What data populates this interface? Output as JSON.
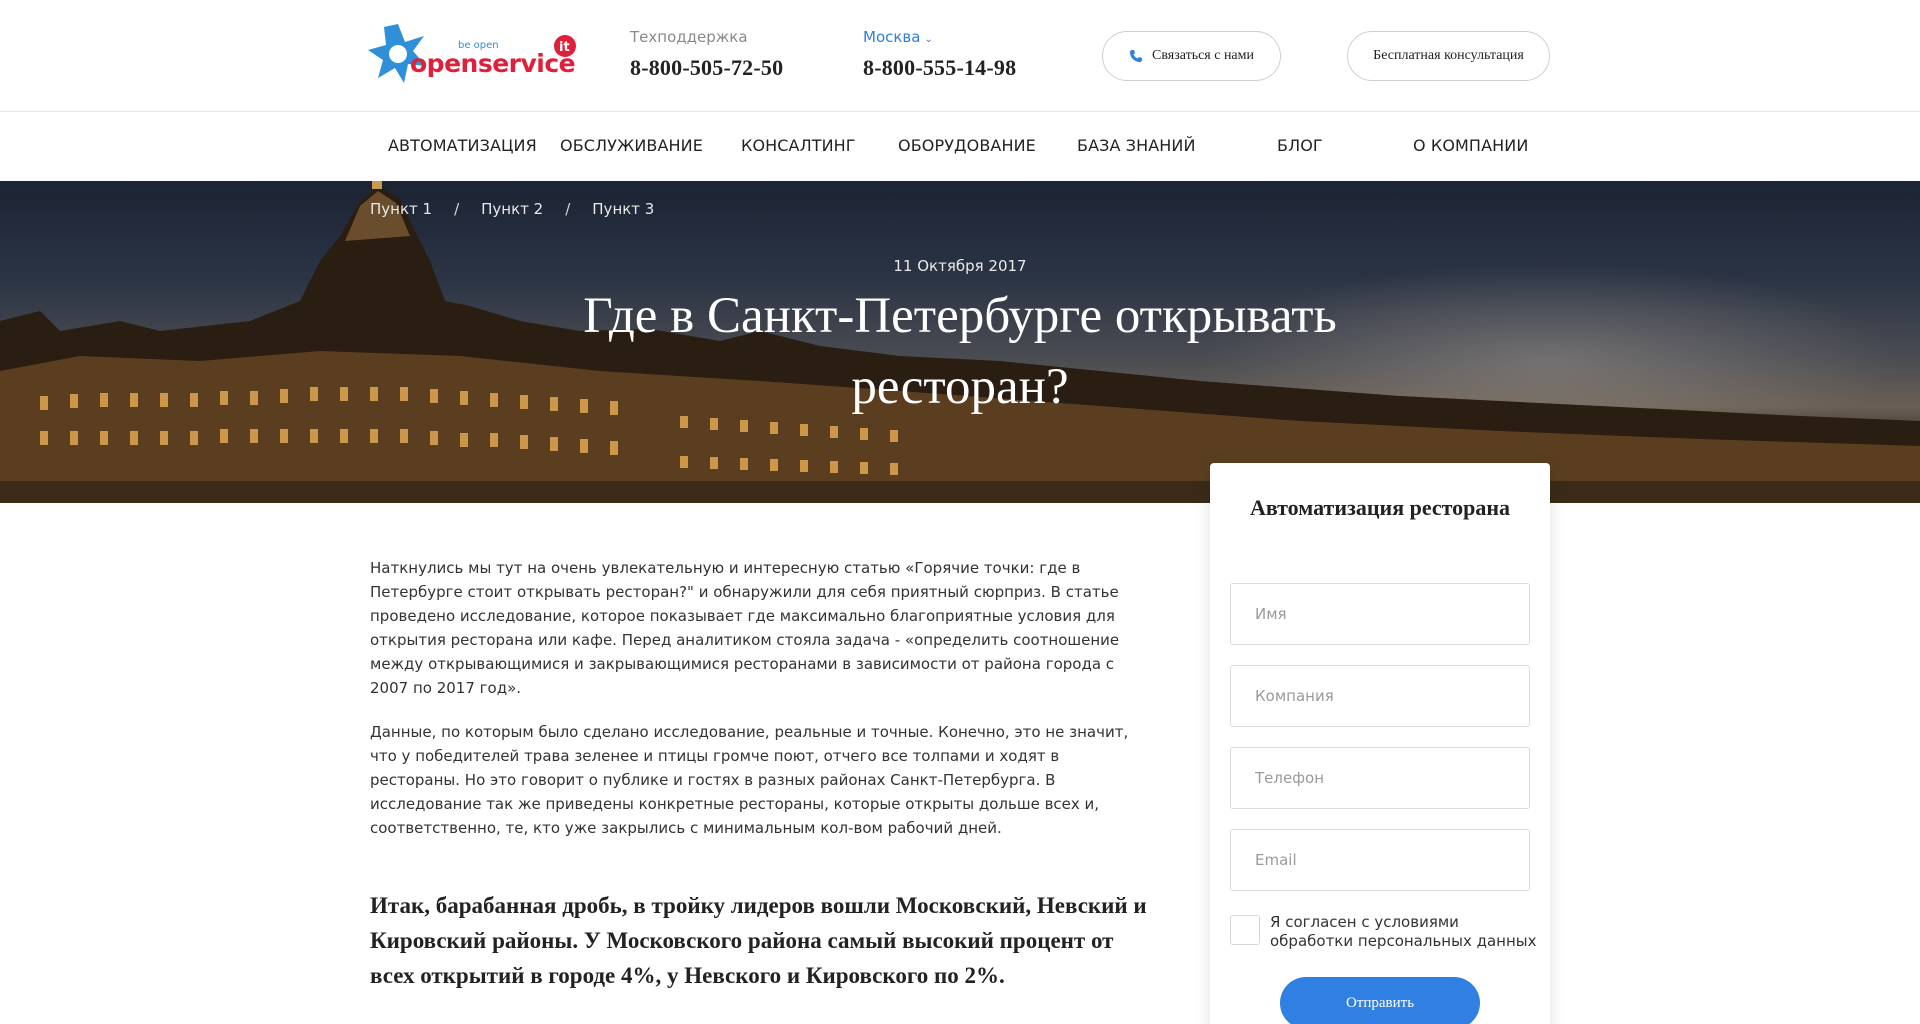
{
  "header": {
    "logo": {
      "small_text": "be open",
      "main_text": "openservice",
      "badge": "it",
      "icon": "star-snowflake-icon"
    },
    "support": {
      "label": "Техподдержка",
      "phone": "8-800-505-72-50"
    },
    "city": {
      "label": "Москва",
      "phone": "8-800-555-14-98"
    },
    "contact_button": "Связаться с нами",
    "consult_button": "Бесплатная консультация"
  },
  "nav": {
    "items": [
      {
        "label": "АВТОМАТИЗАЦИЯ"
      },
      {
        "label": "ОБСЛУЖИВАНИЕ"
      },
      {
        "label": "КОНСАЛТИНГ"
      },
      {
        "label": "ОБОРУДОВАНИЕ"
      },
      {
        "label": "БАЗА ЗНАНИЙ"
      },
      {
        "label": "БЛОГ"
      },
      {
        "label": "О КОМПАНИИ"
      }
    ]
  },
  "hero": {
    "breadcrumb": [
      "Пункт 1",
      "Пункт 2",
      "Пункт 3"
    ],
    "breadcrumb_sep": "/",
    "date": "11 Октября 2017",
    "title": "Где в Санкт-Петербурге открывать ресторан?"
  },
  "article": {
    "paragraphs": [
      "Наткнулись мы тут на очень увлекательную и интересную статью «Горячие точки: где в Петербурге стоит открывать ресторан?\" и обнаружили для себя приятный сюрприз. В статье проведено исследование, которое показывает где максимально благоприятные условия для открытия ресторана или кафе. Перед аналитиком стояла задача - «определить соотношение между открывающимися и закрывающимися ресторанами в зависимости от района города с 2007 по 2017 год».",
      "Данные, по которым было сделано исследование, реальные и точные. Конечно, это не значит, что у победителей трава зеленее и птицы громче поют, отчего все толпами и ходят в рестораны. Но это говорит о публике и гостях в разных районах Санкт-Петербурга. В исследование так же приведены конкретные рестораны, которые открыты дольше всех и, соответственно, те, кто уже закрылись с минимальным кол-вом рабочий дней."
    ],
    "highlight": "Итак, барабанная дробь, в тройку лидеров вошли Московский, Невский и Кировский районы. У Московского района самый высокий процент от всех открытий в городе 4%, у Невского и Кировского по 2%."
  },
  "form": {
    "title": "Автоматизация ресторана",
    "name_placeholder": "Имя",
    "company_placeholder": "Компания",
    "phone_placeholder": "Телефон",
    "email_placeholder": "Email",
    "consent": "Я согласен с условиями обработки персональных данных",
    "submit": "Отправить"
  },
  "colors": {
    "accent": "#2f80e2",
    "logo_blue": "#2f8fd8",
    "logo_red": "#e0203a"
  }
}
